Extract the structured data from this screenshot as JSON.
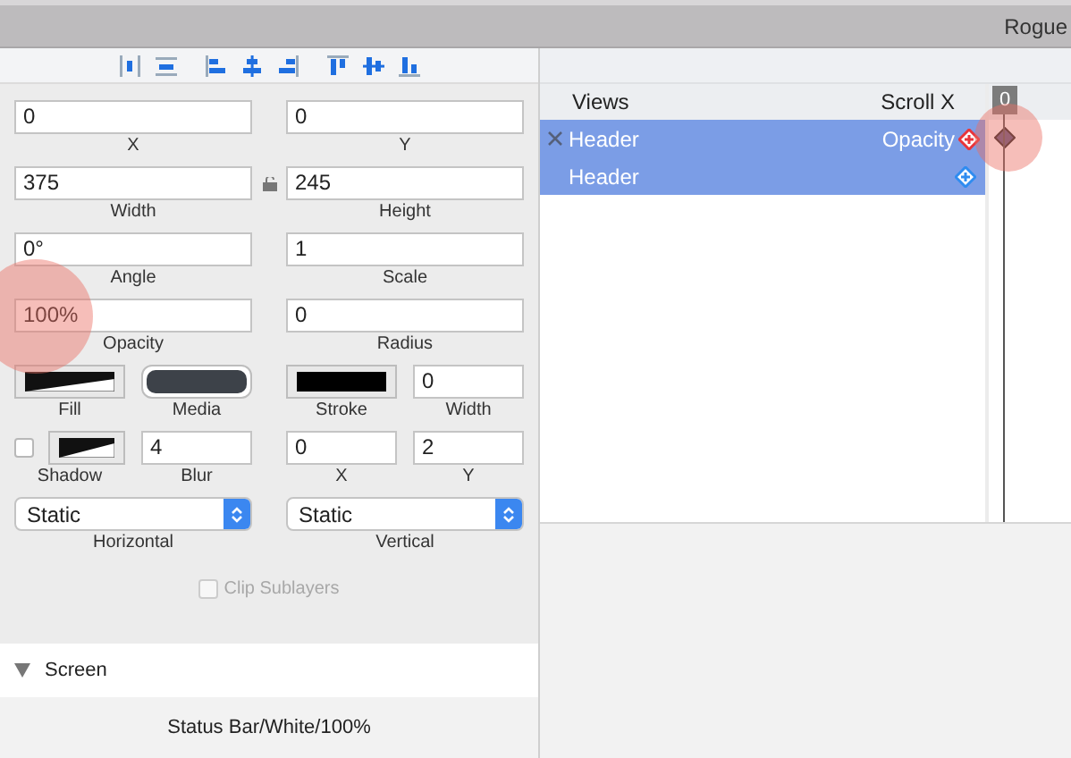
{
  "window": {
    "title": "Rogue"
  },
  "inspector": {
    "rows": [
      {
        "linked": false,
        "cells": [
          {
            "kind": "field",
            "value": "0",
            "label": "X"
          },
          {
            "kind": "field",
            "value": "0",
            "label": "Y"
          }
        ]
      },
      {
        "linked": true,
        "cells": [
          {
            "kind": "field",
            "value": "375",
            "label": "Width"
          },
          {
            "kind": "field",
            "value": "245",
            "label": "Height"
          }
        ]
      },
      {
        "linked": false,
        "cells": [
          {
            "kind": "field",
            "value": "0°",
            "label": "Angle"
          },
          {
            "kind": "field",
            "value": "1",
            "label": "Scale"
          }
        ]
      },
      {
        "linked": false,
        "cells": [
          {
            "kind": "field",
            "value": "100%",
            "label": "Opacity"
          },
          {
            "kind": "field",
            "value": "0",
            "label": "Radius"
          }
        ]
      },
      {
        "linked": false,
        "cells": [
          {
            "kind": "fill",
            "label": "Fill"
          },
          {
            "kind": "media",
            "label": "Media"
          },
          {
            "kind": "stroke",
            "label": "Stroke"
          },
          {
            "kind": "field",
            "value": "0",
            "label": "Width"
          }
        ]
      },
      {
        "linked": false,
        "cells": [
          {
            "kind": "shadow",
            "checked": false,
            "label": "Shadow"
          },
          {
            "kind": "field",
            "value": "4",
            "label": "Blur"
          },
          {
            "kind": "field",
            "value": "0",
            "label": "X"
          },
          {
            "kind": "field",
            "value": "2",
            "label": "Y"
          }
        ]
      },
      {
        "linked": false,
        "cells": [
          {
            "kind": "select",
            "value": "Static",
            "label": "Horizontal"
          },
          {
            "kind": "select",
            "value": "Static",
            "label": "Vertical"
          }
        ]
      }
    ],
    "clip_sublayers": {
      "label": "Clip Sublayers",
      "checked": false,
      "disabled": true
    }
  },
  "screen_section": {
    "title": "Screen",
    "expanded": true,
    "items": [
      "Status Bar/White/100%"
    ]
  },
  "timeline": {
    "columns": [
      "Views",
      "Scroll X"
    ],
    "playhead": "0",
    "rows": [
      {
        "name": "Header",
        "property": "Opacity",
        "selected": true,
        "removable": true,
        "color": "#e8343a",
        "keyframe": true
      },
      {
        "name": "Header",
        "selected": true,
        "removable": false,
        "color": "#2f8cf0",
        "keyframe": false
      }
    ]
  }
}
